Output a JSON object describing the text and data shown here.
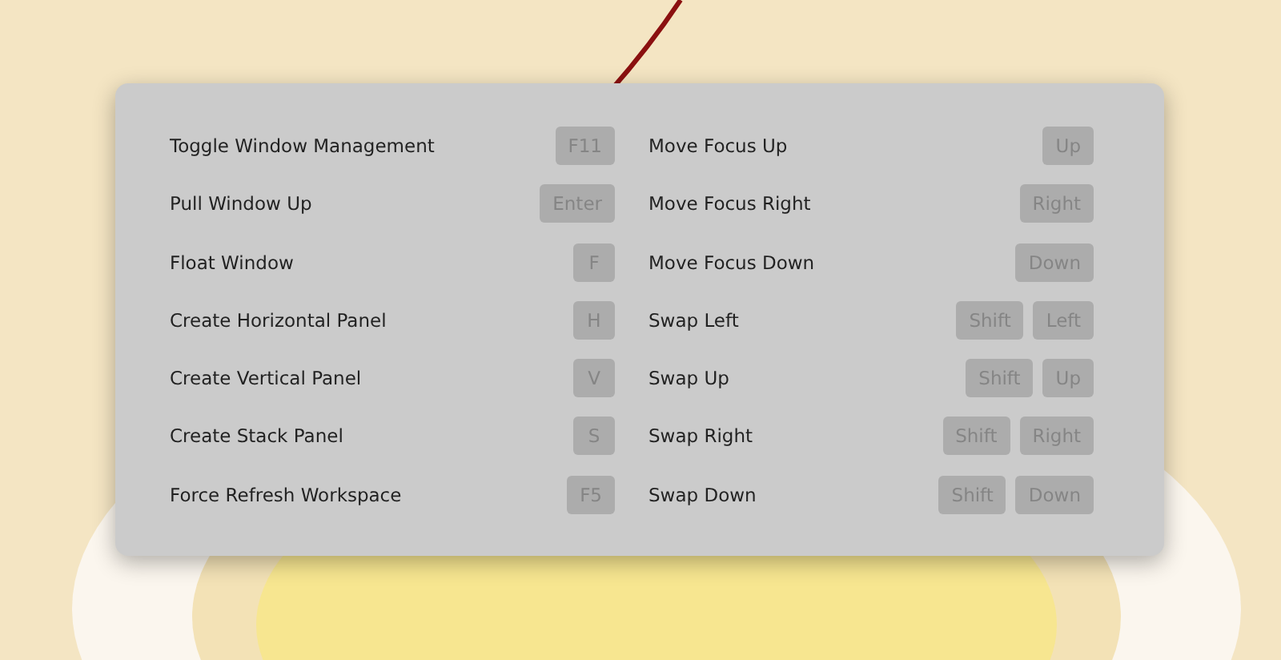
{
  "columns": [
    {
      "shortcuts": [
        {
          "label": "Toggle Window Management",
          "keys": [
            "F11"
          ]
        },
        {
          "label": "Pull Window Up",
          "keys": [
            "Enter"
          ]
        },
        {
          "label": "Float Window",
          "keys": [
            "F"
          ]
        },
        {
          "label": "Create Horizontal Panel",
          "keys": [
            "H"
          ]
        },
        {
          "label": "Create Vertical Panel",
          "keys": [
            "V"
          ]
        },
        {
          "label": "Create Stack Panel",
          "keys": [
            "S"
          ]
        },
        {
          "label": "Force Refresh Workspace",
          "keys": [
            "F5"
          ]
        }
      ]
    },
    {
      "shortcuts": [
        {
          "label": "Move Focus Up",
          "keys": [
            "Up"
          ]
        },
        {
          "label": "Move Focus Right",
          "keys": [
            "Right"
          ]
        },
        {
          "label": "Move Focus Down",
          "keys": [
            "Down"
          ]
        },
        {
          "label": "Swap Left",
          "keys": [
            "Shift",
            "Left"
          ]
        },
        {
          "label": "Swap Up",
          "keys": [
            "Shift",
            "Up"
          ]
        },
        {
          "label": "Swap Right",
          "keys": [
            "Shift",
            "Right"
          ]
        },
        {
          "label": "Swap Down",
          "keys": [
            "Shift",
            "Down"
          ]
        }
      ]
    }
  ]
}
